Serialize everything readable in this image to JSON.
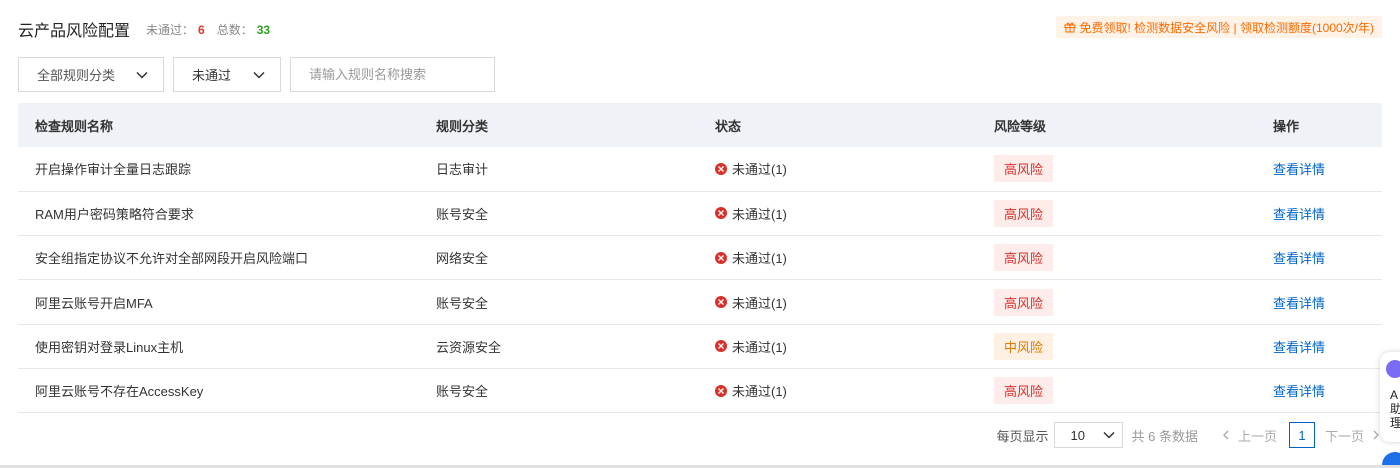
{
  "header": {
    "title": "云产品风险配置",
    "failed_label": "未通过：",
    "failed_count": "6",
    "total_label": "总数：",
    "total_count": "33",
    "promo": "免费领取! 检测数据安全风险 | 领取检测额度(1000次/年)",
    "promo_icon": "gift-icon"
  },
  "filters": {
    "category": "全部规则分类",
    "status": "未通过",
    "search_placeholder": "请输入规则名称搜索",
    "search_icon": "search-icon"
  },
  "table": {
    "columns": [
      "检查规则名称",
      "规则分类",
      "状态",
      "风险等级",
      "操作"
    ],
    "rows": [
      {
        "name": "开启操作审计全量日志跟踪",
        "category": "日志审计",
        "status": "未通过(1)",
        "risk": "高风险",
        "action": "查看详情"
      },
      {
        "name": "RAM用户密码策略符合要求",
        "category": "账号安全",
        "status": "未通过(1)",
        "risk": "高风险",
        "action": "查看详情"
      },
      {
        "name": "安全组指定协议不允许对全部网段开启风险端口",
        "category": "网络安全",
        "status": "未通过(1)",
        "risk": "高风险",
        "action": "查看详情"
      },
      {
        "name": "阿里云账号开启MFA",
        "category": "账号安全",
        "status": "未通过(1)",
        "risk": "高风险",
        "action": "查看详情"
      },
      {
        "name": "使用密钥对登录Linux主机",
        "category": "云资源安全",
        "status": "未通过(1)",
        "risk": "中风险",
        "action": "查看详情"
      },
      {
        "name": "阿里云账号不存在AccessKey",
        "category": "账号安全",
        "status": "未通过(1)",
        "risk": "高风险",
        "action": "查看详情"
      }
    ]
  },
  "pagination": {
    "page_size_label": "每页显示",
    "page_size": "10",
    "total": "共 6 条数据",
    "prev": "上一页",
    "current": "1",
    "next": "下一页"
  },
  "assistant": {
    "text": "A助理"
  },
  "colors": {
    "accent": "#0064c8",
    "danger": "#d9302a",
    "warning": "#e27b00",
    "promo": "#ff6a00"
  }
}
